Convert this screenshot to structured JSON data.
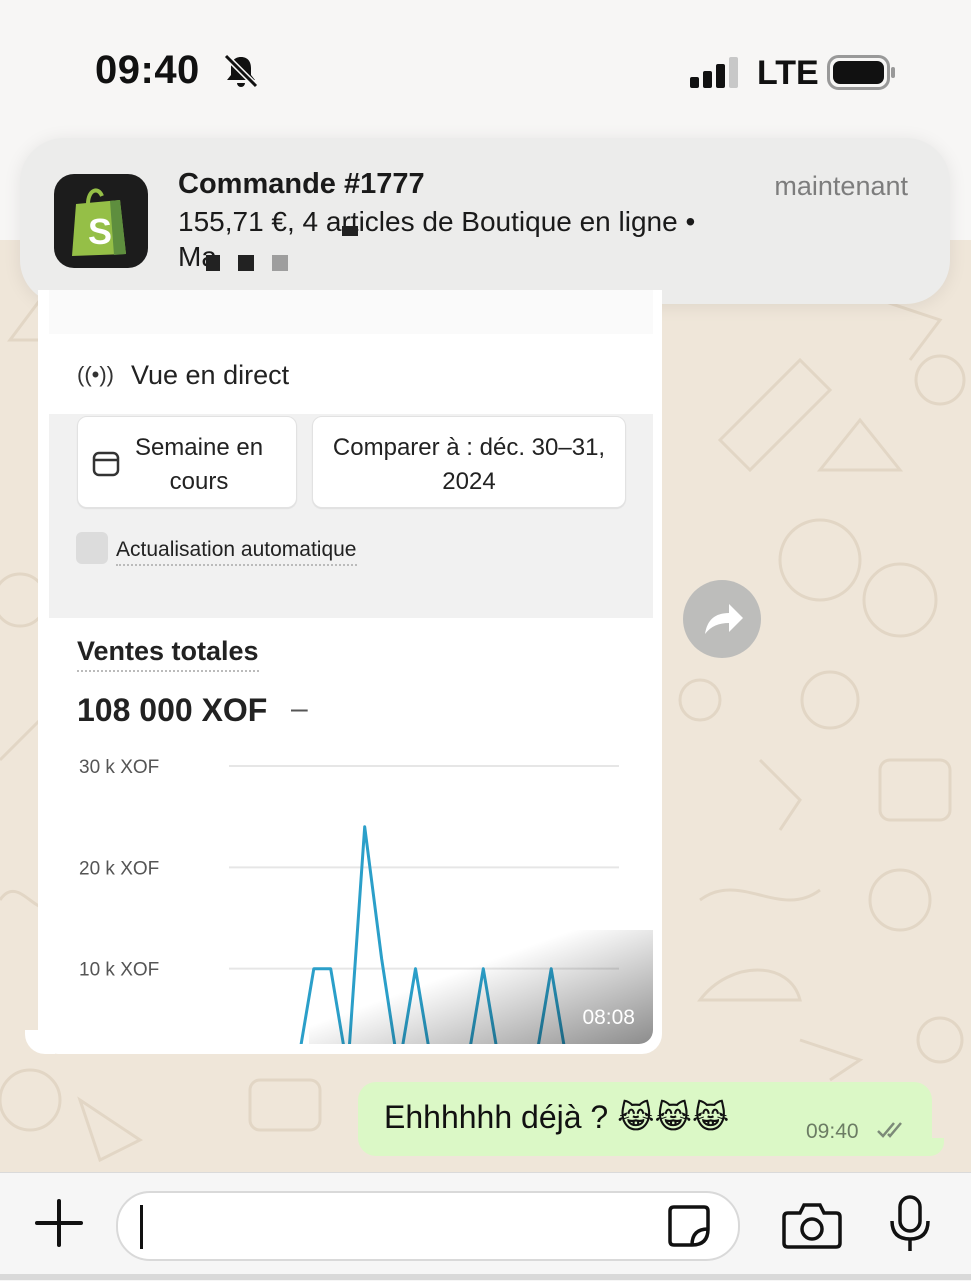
{
  "status_bar": {
    "time": "09:40",
    "network": "LTE",
    "icons": [
      "bell-slash-icon",
      "signal-icon",
      "battery-icon"
    ]
  },
  "notification": {
    "app": "Shopify",
    "title": "Commande #1777",
    "time": "maintenant",
    "body_line1": "155,71 €, 4 articles de Boutique en ligne •",
    "body_line2": "Ma"
  },
  "shared_screenshot": {
    "live_label": "Vue en direct",
    "period_button": "Semaine en cours",
    "compare_button": "Comparer à : déc. 30–31, 2024",
    "auto_refresh_label": "Actualisation automatique",
    "sales_title": "Ventes totales",
    "sales_value": "108 000 XOF",
    "sales_dash": "–",
    "timestamp": "08:08"
  },
  "chart_data": {
    "type": "line",
    "ylabels": [
      "30 k XOF",
      "20 k XOF",
      "10 k XOF"
    ],
    "ylim": [
      0,
      30000
    ],
    "grid": true,
    "series": [
      {
        "values": [
          0,
          0,
          0,
          0,
          0,
          10000,
          10000,
          0,
          24000,
          11000,
          0,
          10000,
          0,
          0,
          0,
          10000,
          0,
          0,
          0,
          10000,
          0,
          0,
          0,
          0
        ]
      }
    ]
  },
  "outgoing_message": {
    "text": "Ehhhhhh déjà ? 😹😹😹",
    "time": "09:40"
  },
  "input_bar": {
    "value": ""
  },
  "colors": {
    "bubble_out": "#dbf8c6",
    "chart_line": "#2b9fc9",
    "chat_bg": "#efe6d9"
  }
}
